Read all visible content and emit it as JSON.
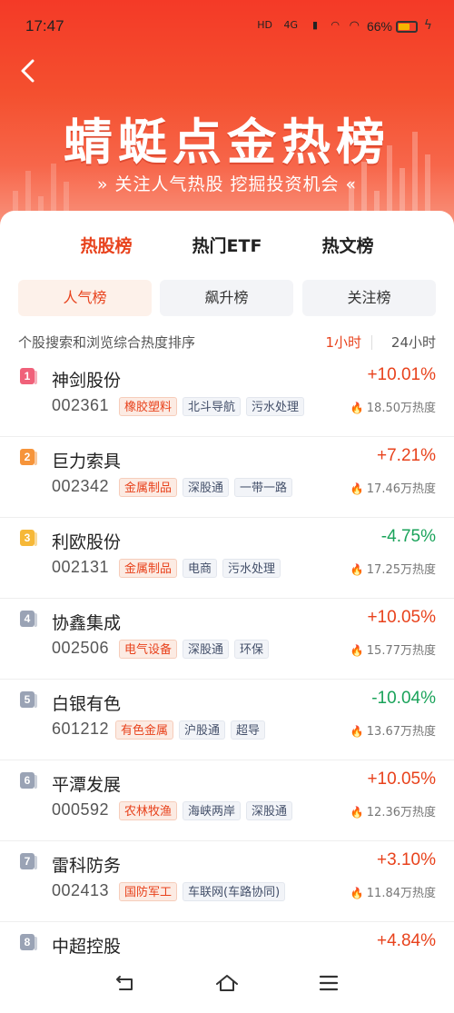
{
  "status": {
    "time": "17:47",
    "network": "4G",
    "battery": "66%"
  },
  "banner": {
    "title": "蜻蜓点金热榜",
    "subtitle": "» 关注人气热股 挖掘投资机会 «"
  },
  "tabs": [
    {
      "label": "热股榜",
      "active": true
    },
    {
      "label": "热门ETF",
      "active": false
    },
    {
      "label": "热文榜",
      "active": false
    }
  ],
  "subtabs": [
    {
      "label": "人气榜",
      "active": true
    },
    {
      "label": "飙升榜",
      "active": false
    },
    {
      "label": "关注榜",
      "active": false
    }
  ],
  "description": "个股搜索和浏览综合热度排序",
  "periods": [
    {
      "label": "1小时",
      "active": true
    },
    {
      "label": "24小时",
      "active": false
    }
  ],
  "colors": {
    "accent": "#e8421c",
    "up": "#e8421c",
    "down": "#1aa35a",
    "rank1": "#f0617a",
    "rank2": "#f6943a",
    "rank3": "#f6b838",
    "rankOther": "#9aa3b5"
  },
  "stocks": [
    {
      "rank": "1",
      "name": "神剑股份",
      "code": "002361",
      "tags": [
        "橡胶塑料",
        "北斗导航",
        "污水处理"
      ],
      "change": "+10.01%",
      "direction": "up",
      "heat": "18.50万热度"
    },
    {
      "rank": "2",
      "name": "巨力索具",
      "code": "002342",
      "tags": [
        "金属制品",
        "深股通",
        "一带一路"
      ],
      "change": "+7.21%",
      "direction": "up",
      "heat": "17.46万热度"
    },
    {
      "rank": "3",
      "name": "利欧股份",
      "code": "002131",
      "tags": [
        "金属制品",
        "电商",
        "污水处理"
      ],
      "change": "-4.75%",
      "direction": "down",
      "heat": "17.25万热度"
    },
    {
      "rank": "4",
      "name": "协鑫集成",
      "code": "002506",
      "tags": [
        "电气设备",
        "深股通",
        "环保"
      ],
      "change": "+10.05%",
      "direction": "up",
      "heat": "15.77万热度"
    },
    {
      "rank": "5",
      "name": "白银有色",
      "code": "601212",
      "tags": [
        "有色金属",
        "沪股通",
        "超导"
      ],
      "change": "-10.04%",
      "direction": "down",
      "heat": "13.67万热度"
    },
    {
      "rank": "6",
      "name": "平潭发展",
      "code": "000592",
      "tags": [
        "农林牧渔",
        "海峡两岸",
        "深股通"
      ],
      "change": "+10.05%",
      "direction": "up",
      "heat": "12.36万热度"
    },
    {
      "rank": "7",
      "name": "雷科防务",
      "code": "002413",
      "tags": [
        "国防军工",
        "车联网(车路协同)"
      ],
      "change": "+3.10%",
      "direction": "up",
      "heat": "11.84万热度"
    },
    {
      "rank": "8",
      "name": "中超控股",
      "code": "",
      "tags": [],
      "change": "+4.84%",
      "direction": "up",
      "heat": ""
    }
  ]
}
